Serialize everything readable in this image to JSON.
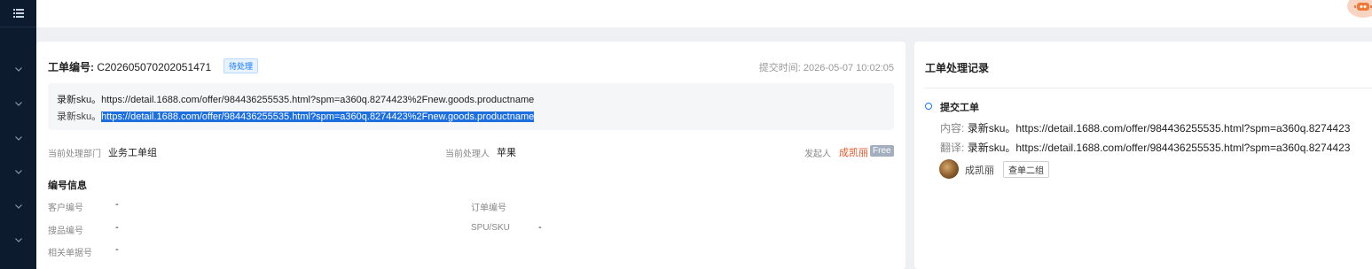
{
  "sidebar": {
    "menu_icon": "list-icon",
    "nav_icon": "chevron-down-icon",
    "nav_items_count_visible": 6
  },
  "topbar": {
    "assistant_icon": "robot-icon"
  },
  "ticket": {
    "title_label": "工单编号:",
    "number": "C202605070202051471",
    "status": "待处理",
    "submit_time_label": "提交时间:",
    "submit_time": "2026-05-07 10:02:05",
    "content_line1": "录新sku。https://detail.1688.com/offer/984436255535.html?spm=a360q.8274423%2Fnew.goods.productname",
    "content_line2_prefix": "录新sku。",
    "content_line2_link": "https://detail.1688.com/offer/984436255535.html?spm=a360q.8274423%2Fnew.goods.productname",
    "dept_label": "当前处理部门",
    "dept_value": "业务工单组",
    "handler_label": "当前处理人",
    "handler_value": "苹果",
    "initiator_label": "发起人",
    "initiator_value": "成凯丽",
    "initiator_tag": "Free"
  },
  "numbers_section": {
    "title": "编号信息",
    "customer_no_label": "客户编号",
    "customer_no_value": "-",
    "order_no_label": "订单编号",
    "order_no_value": "",
    "search_no_label": "搜品编号",
    "search_no_value": "-",
    "spu_sku_label": "SPU/SKU",
    "spu_sku_value": "-",
    "related_no_label": "相关单据号",
    "related_no_value": "-"
  },
  "history": {
    "title": "工单处理记录",
    "event_title": "提交工单",
    "content_label": "内容:",
    "content_value": "录新sku。https://detail.1688.com/offer/984436255535.html?spm=a360q.8274423",
    "translation_label": "翻译:",
    "translation_value": "录新sku。https://detail.1688.com/offer/984436255535.html?spm=a360q.8274423",
    "user_name": "成凯丽",
    "user_group": "查单二组"
  },
  "colors": {
    "sidebar_bg": "#0d1b2e",
    "accent": "#1677ff",
    "initiator": "#e8572a",
    "selection": "#1d6fe0"
  }
}
